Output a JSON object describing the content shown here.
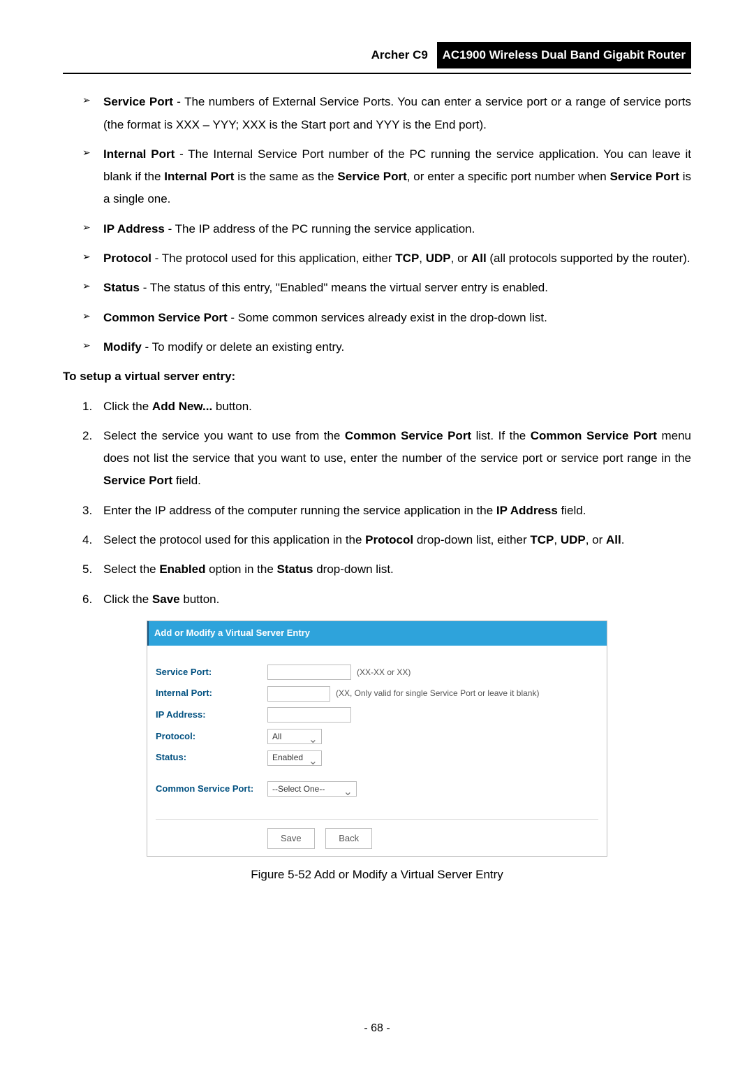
{
  "header": {
    "model": "Archer C9",
    "title": "AC1900 Wireless Dual Band Gigabit Router"
  },
  "bullets": [
    {
      "term": "Service Port",
      "desc": " - The numbers of External Service Ports. You can enter a service port or a range of service ports (the format is XXX – YYY; XXX is the Start port and YYY is the End port)."
    },
    {
      "term": "Internal Port",
      "desc_parts": [
        " - The Internal Service Port number of the PC running the service application. You can leave it blank if the ",
        "Internal Port",
        " is the same as the ",
        "Service Port",
        ", or enter a specific port number when ",
        "Service Port",
        " is a single one."
      ]
    },
    {
      "term": "IP Address",
      "desc": " - The IP address of the PC running the service application."
    },
    {
      "term": "Protocol",
      "desc_parts": [
        " - The protocol used for this application, either ",
        "TCP",
        ", ",
        "UDP",
        ", or ",
        "All",
        " (all protocols supported by the router)."
      ]
    },
    {
      "term": "Status",
      "desc": " - The status of this entry, \"Enabled\" means the virtual server entry is enabled."
    },
    {
      "term": "Common Service Port",
      "desc": " - Some common services already exist in the drop-down list."
    },
    {
      "term": "Modify",
      "desc": " - To modify or delete an existing entry."
    }
  ],
  "setupHeading": "To setup a virtual server entry:",
  "steps": [
    {
      "num": "1.",
      "parts": [
        "Click the ",
        "Add New...",
        " button."
      ]
    },
    {
      "num": "2.",
      "parts": [
        "Select the service you want to use from the ",
        "Common Service Port",
        " list. If the ",
        "Common Service Port",
        " menu does not list the service that you want to use, enter the number of the service port or service port range in the ",
        "Service Port",
        " field."
      ]
    },
    {
      "num": "3.",
      "parts": [
        "Enter the IP address of the computer running the service application in the ",
        "IP Address",
        " field."
      ]
    },
    {
      "num": "4.",
      "parts": [
        "Select the protocol used for this application in the ",
        "Protocol",
        " drop-down list, either ",
        "TCP",
        ", ",
        "UDP",
        ", or ",
        "All",
        "."
      ]
    },
    {
      "num": "5.",
      "parts": [
        "Select the ",
        "Enabled",
        " option in the ",
        "Status",
        " drop-down list."
      ]
    },
    {
      "num": "6.",
      "parts": [
        "Click the ",
        "Save",
        " button."
      ]
    }
  ],
  "form": {
    "title": "Add or Modify a Virtual Server Entry",
    "labels": {
      "servicePort": "Service Port:",
      "internalPort": "Internal Port:",
      "ipAddress": "IP Address:",
      "protocol": "Protocol:",
      "status": "Status:",
      "commonServicePort": "Common Service Port:"
    },
    "hints": {
      "servicePort": "(XX-XX or XX)",
      "internalPort": "(XX, Only valid for single Service Port or leave it blank)"
    },
    "values": {
      "protocol": "All",
      "status": "Enabled",
      "commonServicePort": "--Select One--"
    },
    "buttons": {
      "save": "Save",
      "back": "Back"
    }
  },
  "figureCaption": "Figure 5-52 Add or Modify a Virtual Server Entry",
  "pageNumber": "- 68 -"
}
